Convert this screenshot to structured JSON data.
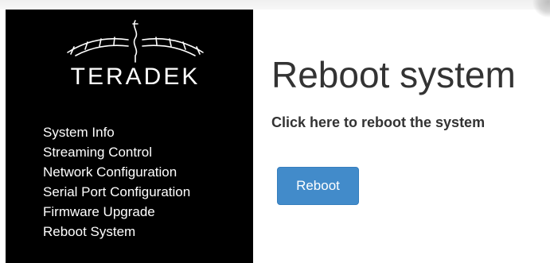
{
  "brand": {
    "logo_text": "TERADEK"
  },
  "sidebar": {
    "items": [
      {
        "label": "System Info"
      },
      {
        "label": "Streaming Control"
      },
      {
        "label": "Network Configuration"
      },
      {
        "label": "Serial Port Configuration"
      },
      {
        "label": "Firmware Upgrade"
      },
      {
        "label": "Reboot System"
      }
    ]
  },
  "main": {
    "title": "Reboot system",
    "subtitle": "Click here to reboot the system",
    "reboot_button_label": "Reboot"
  },
  "colors": {
    "sidebar_bg": "#000000",
    "sidebar_text": "#ffffff",
    "button_bg": "#428bca",
    "heading_text": "#333333"
  },
  "icons": {
    "logo": "teradek-wing-logo"
  }
}
